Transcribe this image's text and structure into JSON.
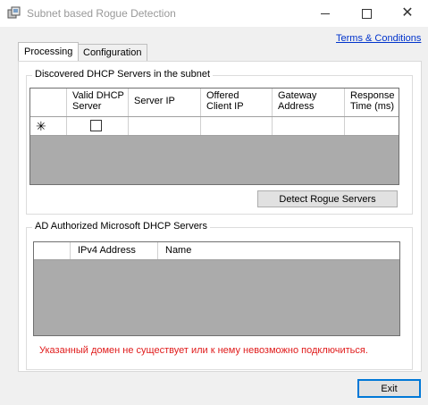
{
  "window": {
    "title": "Subnet based Rogue Detection",
    "controls": {
      "minimize": "",
      "maximize": "",
      "close": "✕"
    }
  },
  "tabs": [
    {
      "label": "Processing",
      "active": true
    },
    {
      "label": "Configuration",
      "active": false
    }
  ],
  "terms_link": "Terms & Conditions",
  "discovered": {
    "group_title": "Discovered DHCP Servers in the subnet",
    "columns": [
      {
        "l1": "Valid DHCP",
        "l2": "Server"
      },
      {
        "l1": "Server IP",
        "l2": ""
      },
      {
        "l1": "Offered",
        "l2": "Client IP"
      },
      {
        "l1": "Gateway",
        "l2": "Address"
      },
      {
        "l1": "Response",
        "l2": "Time (ms)"
      }
    ],
    "new_row_glyph": "✳",
    "detect_button": "Detect Rogue Servers"
  },
  "authorized": {
    "group_title": "AD Authorized Microsoft DHCP Servers",
    "columns": [
      "IPv4 Address",
      "Name"
    ]
  },
  "error_message": "Указанный домен не существует или к нему невозможно подключиться.",
  "exit_button": "Exit",
  "colors": {
    "error": "#e01b1b",
    "link": "#0033cc",
    "grid_background": "#ababab",
    "focus_border": "#0078d7"
  }
}
